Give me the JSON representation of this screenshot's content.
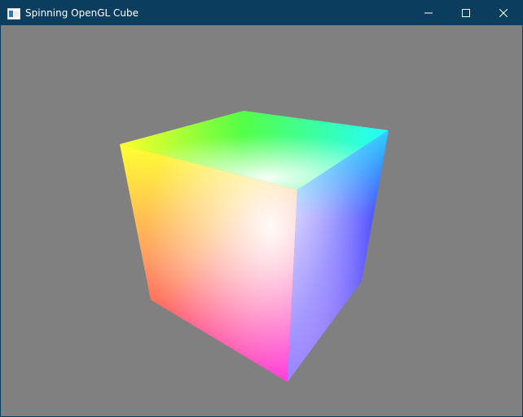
{
  "window": {
    "title": "Spinning OpenGL Cube",
    "background_color": "#808080",
    "titlebar_color": "#0b3d5f"
  },
  "titlebar": {
    "app_icon": "window-app-icon",
    "buttons": [
      {
        "name": "minimize",
        "icon": "minimize-icon"
      },
      {
        "name": "maximize",
        "icon": "maximize-icon"
      },
      {
        "name": "close",
        "icon": "close-icon"
      }
    ]
  },
  "scene": {
    "object": "rgb-color-cube",
    "face_colors": {
      "yellow": "#ffff00",
      "green": "#00ff00",
      "cyan": "#00ffff",
      "white": "#ffffff",
      "red": "#ff0000",
      "magenta": "#ff00ff",
      "blue": "#0000ff",
      "purple": "#8000ff"
    }
  }
}
